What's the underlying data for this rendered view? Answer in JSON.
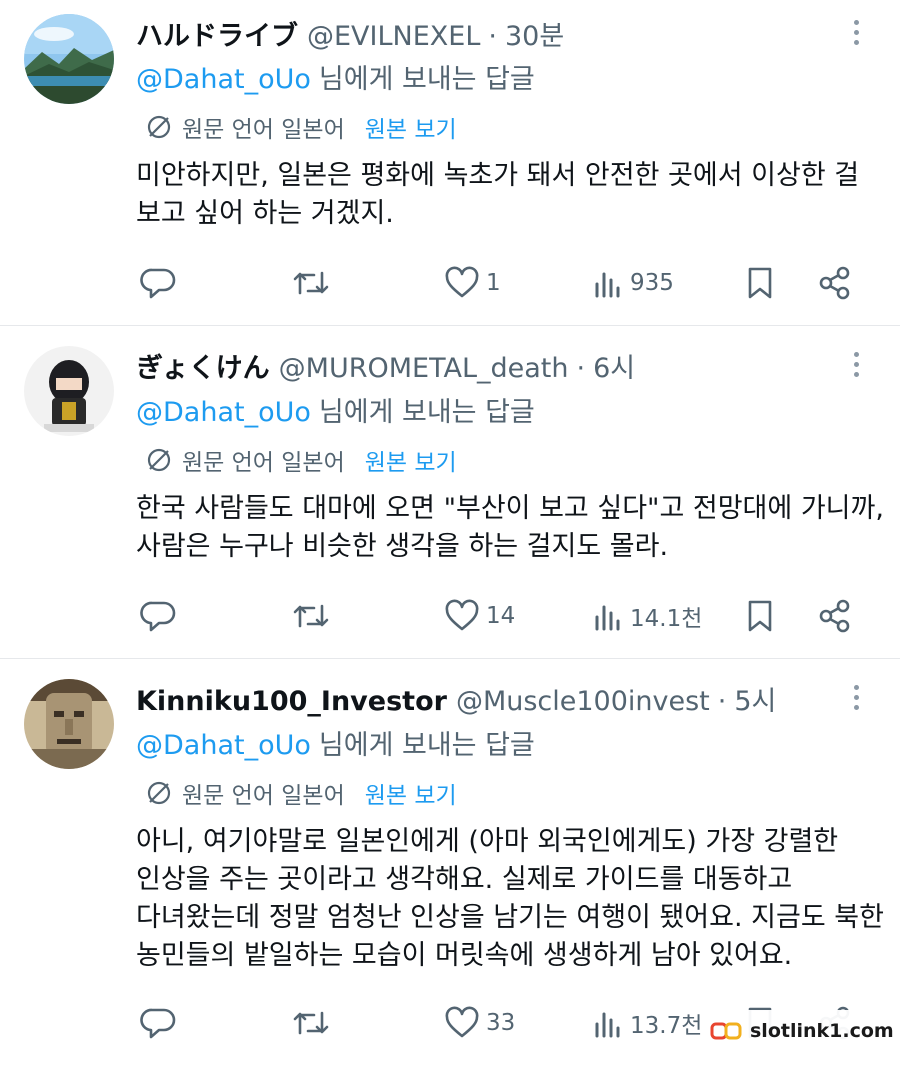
{
  "tweets": [
    {
      "display_name": "ハルドライブ",
      "handle": "@EVILNEXEL",
      "separator": "·",
      "time": "30분",
      "reply_mention": "@Dahat_oUo",
      "reply_text": "님에게 보내는 답글",
      "translate_label": "원문 언어 일본어",
      "translate_link": "원본 보기",
      "body": [
        "미안하지만, 일본은 평화에 녹초가 돼서 안전한 곳에서 이상한 걸",
        "보고 싶어 하는 거겠지."
      ],
      "likes": "1",
      "views": "935"
    },
    {
      "display_name": "ぎょくけん",
      "handle": "@MUROMETAL_death",
      "separator": "·",
      "time": "6시",
      "reply_mention": "@Dahat_oUo",
      "reply_text": "님에게 보내는 답글",
      "translate_label": "원문 언어 일본어",
      "translate_link": "원본 보기",
      "body": [
        "한국 사람들도 대마에 오면 \"부산이 보고 싶다\"고 전망대에 가니까,",
        "사람은 누구나 비슷한 생각을 하는 걸지도 몰라."
      ],
      "likes": "14",
      "views": "14.1천"
    },
    {
      "display_name": "Kinniku100_Investor",
      "handle": "@Muscle100invest",
      "separator": "·",
      "time": "5시",
      "reply_mention": "@Dahat_oUo",
      "reply_text": "님에게 보내는 답글",
      "translate_label": "원문 언어 일본어",
      "translate_link": "원본 보기",
      "body": [
        "아니, 여기야말로 일본인에게 (아마 외국인에게도) 가장 강렬한",
        "인상을 주는 곳이라고 생각해요. 실제로 가이드를 대동하고",
        "다녀왔는데 정말 엄청난 인상을 남기는 여행이 됐어요. 지금도 북한",
        "농민들의 밭일하는 모습이 머릿속에 생생하게 남아 있어요."
      ],
      "likes": "33",
      "views": "13.7천"
    }
  ],
  "watermark": "slotlink1.com",
  "colors": {
    "accent": "#1d9bf0",
    "secondary_text": "#536471",
    "icon": "#536471",
    "divider": "#e6e8eb"
  },
  "icons": [
    "reply-icon",
    "retweet-icon",
    "heart-icon",
    "views-icon",
    "bookmark-icon",
    "share-icon",
    "translate-icon",
    "more-icon"
  ]
}
